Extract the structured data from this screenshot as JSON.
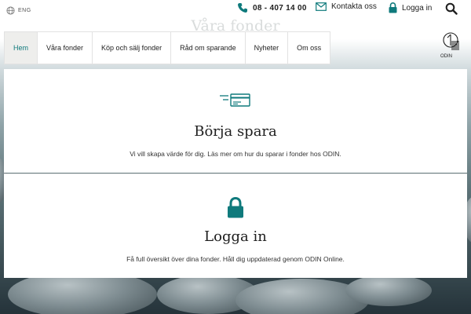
{
  "header": {
    "language": "ENG",
    "phone": "08 - 407 14 00",
    "contact_label": "Kontakta oss",
    "login_label": "Logga in"
  },
  "background_title": "Våra fonder",
  "nav": {
    "items": [
      {
        "label": "Hem",
        "active": true
      },
      {
        "label": "Våra fonder",
        "active": false
      },
      {
        "label": "Köp och sälj fonder",
        "active": false
      },
      {
        "label": "Råd om sparande",
        "active": false
      },
      {
        "label": "Nyheter",
        "active": false
      },
      {
        "label": "Om oss",
        "active": false
      }
    ]
  },
  "logo_text": "ODIN",
  "cards": [
    {
      "icon": "card-payment-icon",
      "title": "Börja spara",
      "description": "Vi vill skapa värde för dig. Läs mer om hur du sparar i fonder hos ODIN."
    },
    {
      "icon": "lock-icon",
      "title": "Logga in",
      "description": "Få full översikt över dina fonder. Håll dig uppdaterad genom ODIN Online."
    }
  ],
  "colors": {
    "accent": "#0f7a7c",
    "text": "#1e1e1e",
    "nav_active_bg": "#eeeeec"
  }
}
